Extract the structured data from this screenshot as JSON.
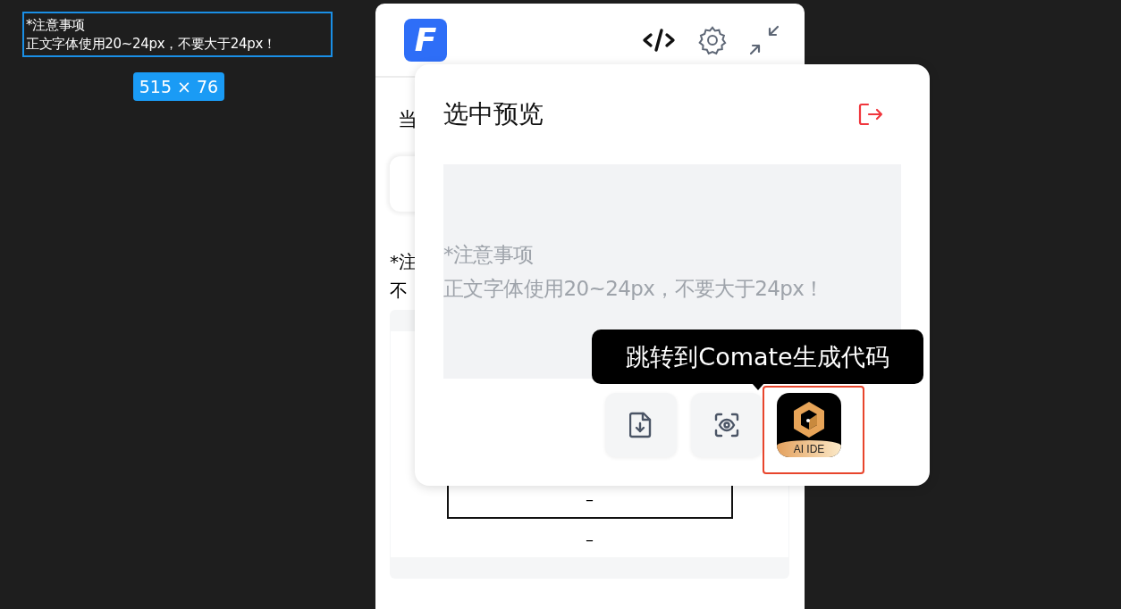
{
  "canvas": {
    "selection_lines": [
      "*注意事项",
      "正文字体使用20~24px，不要大于24px！"
    ],
    "size_badge": "515 × 76"
  },
  "plugin": {
    "logo": "F",
    "heading": "当",
    "note_lines": [
      "*注",
      "不"
    ],
    "table_dashes": [
      "–",
      "–"
    ]
  },
  "popup": {
    "title": "选中预览",
    "preview_lines": [
      "*注意事项",
      "正文字体使用20~24px，不要大于24px！"
    ],
    "actions": [
      {
        "kind": "export",
        "highlighted": false
      },
      {
        "kind": "preview",
        "highlighted": false
      },
      {
        "kind": "ai-ide",
        "label": "AI IDE",
        "highlighted": true
      }
    ],
    "tooltip": "跳转到Comate生成代码"
  }
}
